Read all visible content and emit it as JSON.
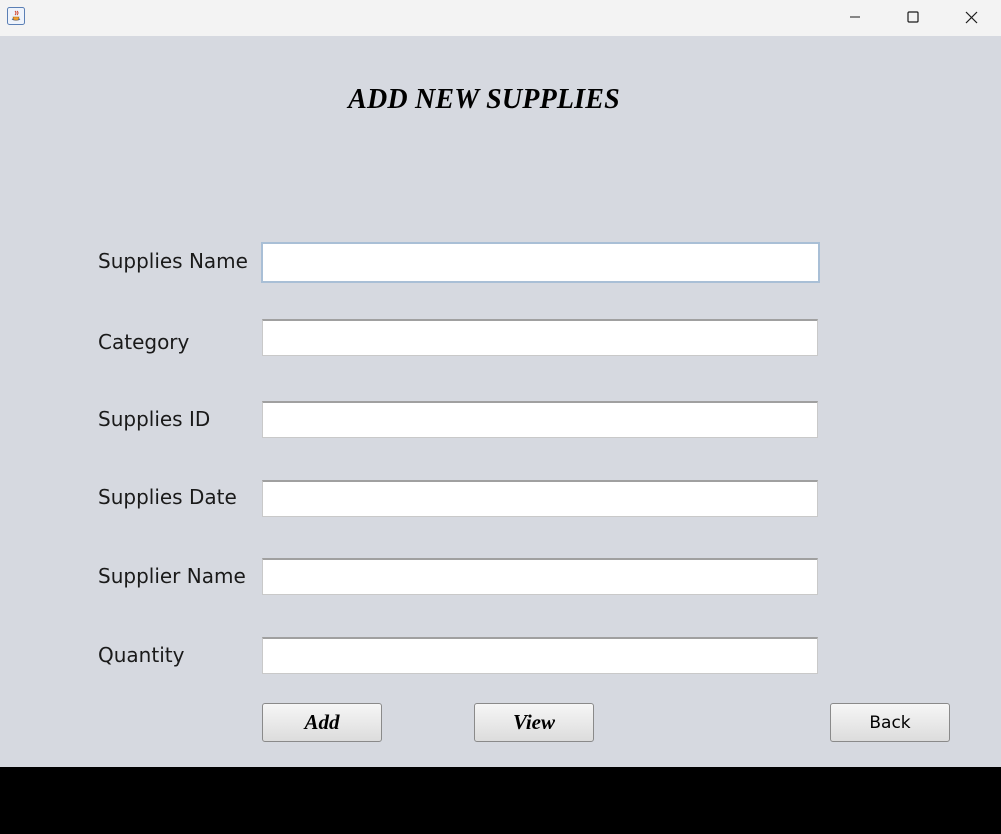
{
  "window": {
    "titlebar_icons": [
      "java-app-icon",
      "minimize-icon",
      "maximize-icon",
      "close-icon"
    ]
  },
  "form": {
    "title": "ADD NEW SUPPLIES",
    "fields": [
      {
        "label": "Supplies Name",
        "value": ""
      },
      {
        "label": "Category",
        "value": ""
      },
      {
        "label": "Supplies ID",
        "value": ""
      },
      {
        "label": "Supplies Date",
        "value": ""
      },
      {
        "label": "Supplier Name",
        "value": ""
      },
      {
        "label": "Quantity",
        "value": ""
      }
    ]
  },
  "buttons": {
    "add": "Add",
    "view": "View",
    "back": "Back"
  },
  "colors": {
    "background": "#d6d9e0",
    "titlebar": "#f3f3f3",
    "focus_border": "#a9bfd6"
  }
}
